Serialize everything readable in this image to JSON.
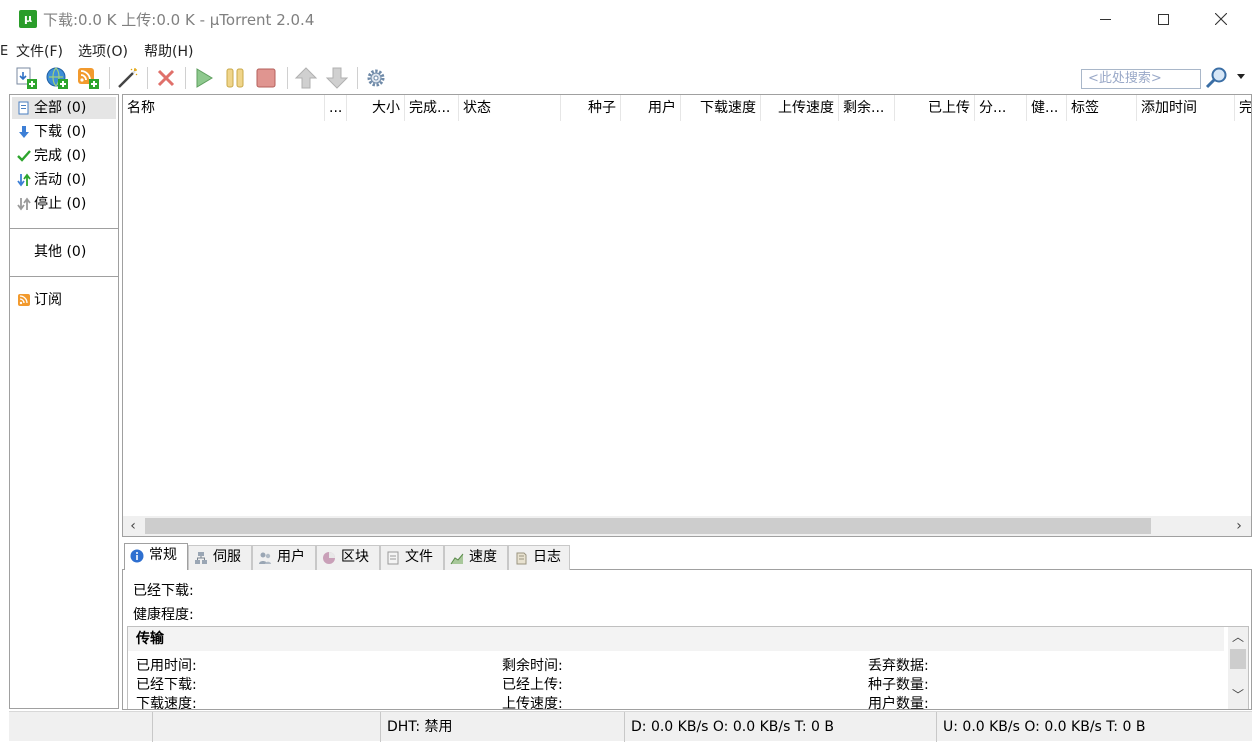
{
  "window": {
    "title": "下载:0.0 K 上传:0.0 K - µTorrent 2.0.4",
    "app_icon_letter": "µ"
  },
  "menu": {
    "items": [
      {
        "label": "文件(F)"
      },
      {
        "label": "选项(O)"
      },
      {
        "label": "帮助(H)"
      }
    ]
  },
  "left_cut_text": "E",
  "toolbar": {
    "buttons": [
      "add-torrent",
      "add-url",
      "add-rss",
      "create-torrent",
      "remove",
      "start",
      "pause",
      "stop",
      "move-up",
      "move-down",
      "preferences"
    ],
    "search_placeholder": "<此处搜索>"
  },
  "sidebar": {
    "items": [
      {
        "label": "全部 (0)",
        "icon": "all-icon"
      },
      {
        "label": "下载 (0)",
        "icon": "download-arrow-icon"
      },
      {
        "label": "完成 (0)",
        "icon": "checkmark-icon"
      },
      {
        "label": "活动 (0)",
        "icon": "active-arrows-icon"
      },
      {
        "label": "停止 (0)",
        "icon": "stopped-arrows-icon"
      }
    ],
    "other": "其他 (0)",
    "feeds": "订阅"
  },
  "list": {
    "columns": [
      "名称",
      "...",
      "大小",
      "完成...",
      "状态",
      "种子",
      "用户",
      "下载速度",
      "上传速度",
      "剩余...",
      "已上传",
      "分...",
      "健...",
      "标签",
      "添加时间",
      "完"
    ]
  },
  "tabs": [
    {
      "label": "常规",
      "icon": "info-icon"
    },
    {
      "label": "伺服",
      "icon": "tracker-icon"
    },
    {
      "label": "用户",
      "icon": "peers-icon"
    },
    {
      "label": "区块",
      "icon": "pieces-icon"
    },
    {
      "label": "文件",
      "icon": "files-icon"
    },
    {
      "label": "速度",
      "icon": "speed-graph-icon"
    },
    {
      "label": "日志",
      "icon": "log-icon"
    }
  ],
  "general": {
    "downloaded_label": "已经下载:",
    "health_label": "健康程度:",
    "transfer_heading": "传输",
    "fields": {
      "elapsed": "已用时间:",
      "remaining": "剩余时间:",
      "wasted": "丢弃数据:",
      "downloaded": "已经下载:",
      "uploaded": "已经上传:",
      "seeds": "种子数量:",
      "dl_speed": "下载速度:",
      "ul_speed": "上传速度:",
      "peers": "用户数量:"
    }
  },
  "statusbar": {
    "dht": "DHT: 禁用",
    "download": "D: 0.0 KB/s O: 0.0 KB/s T: 0 B",
    "upload": "U: 0.0 KB/s O: 0.0 KB/s T: 0 B"
  },
  "colors": {
    "accent_green": "#2a9d2a",
    "border": "#a0a0a0",
    "selected": "#e5e5e5"
  }
}
